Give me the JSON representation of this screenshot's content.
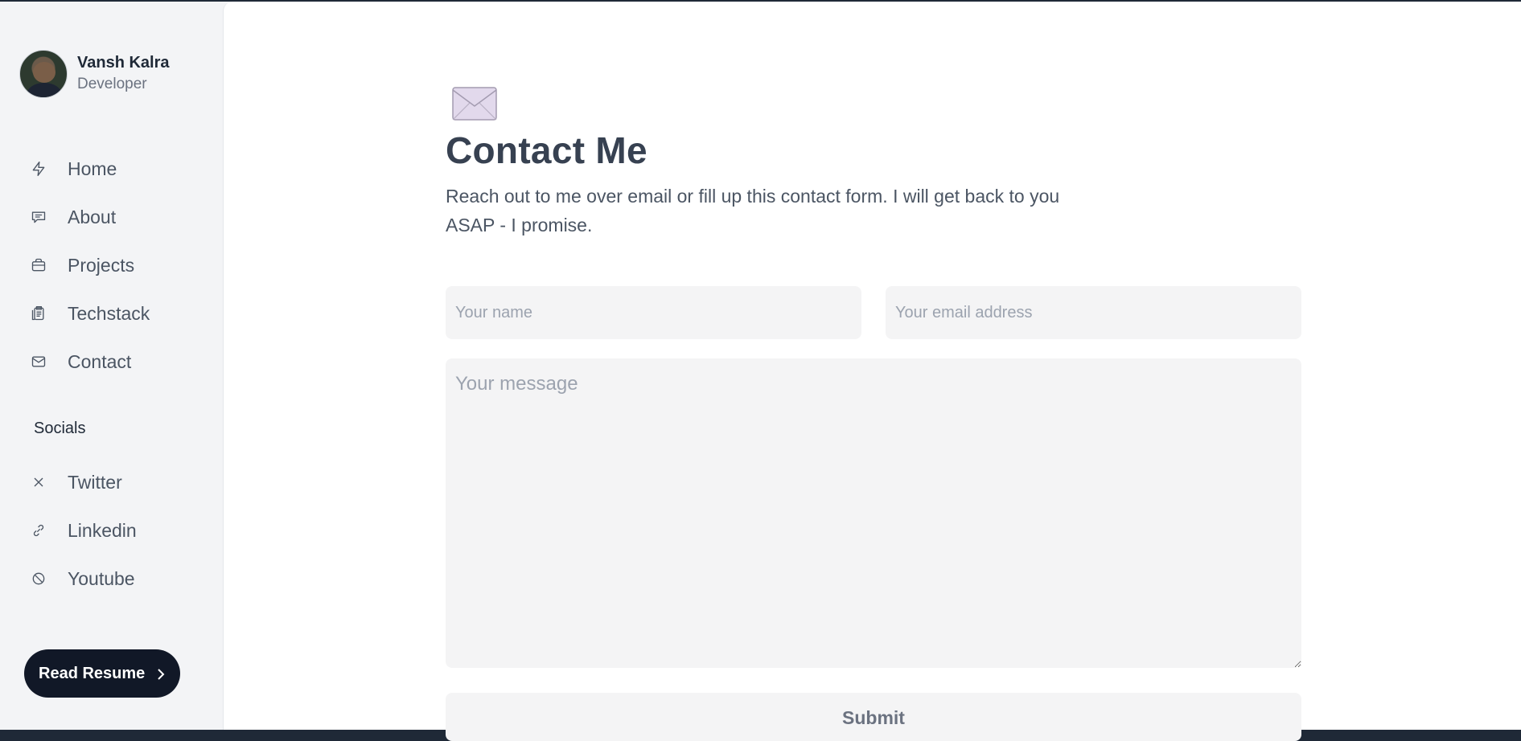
{
  "profile": {
    "name": "Vansh Kalra",
    "role": "Developer"
  },
  "nav": {
    "items": [
      {
        "label": "Home",
        "icon": "bolt-icon"
      },
      {
        "label": "About",
        "icon": "chat-bubble-icon"
      },
      {
        "label": "Projects",
        "icon": "briefcase-icon"
      },
      {
        "label": "Techstack",
        "icon": "clipboard-icon"
      },
      {
        "label": "Contact",
        "icon": "mail-icon"
      }
    ]
  },
  "socials": {
    "title": "Socials",
    "items": [
      {
        "label": "Twitter",
        "icon": "x-icon"
      },
      {
        "label": "Linkedin",
        "icon": "link-icon"
      },
      {
        "label": "Youtube",
        "icon": "circle-slash-icon"
      }
    ]
  },
  "resume_button": {
    "label": "Read Resume"
  },
  "contact": {
    "title": "Contact Me",
    "description": "Reach out to me over email or fill up this contact form. I will get back to you ASAP - I promise.",
    "name_placeholder": "Your name",
    "email_placeholder": "Your email address",
    "message_placeholder": "Your message",
    "submit_label": "Submit"
  },
  "colors": {
    "sidebar_bg": "#f3f4f6",
    "main_bg": "#ffffff",
    "button_dark": "#111827",
    "heading": "#374151",
    "input_bg": "#f4f4f5"
  }
}
